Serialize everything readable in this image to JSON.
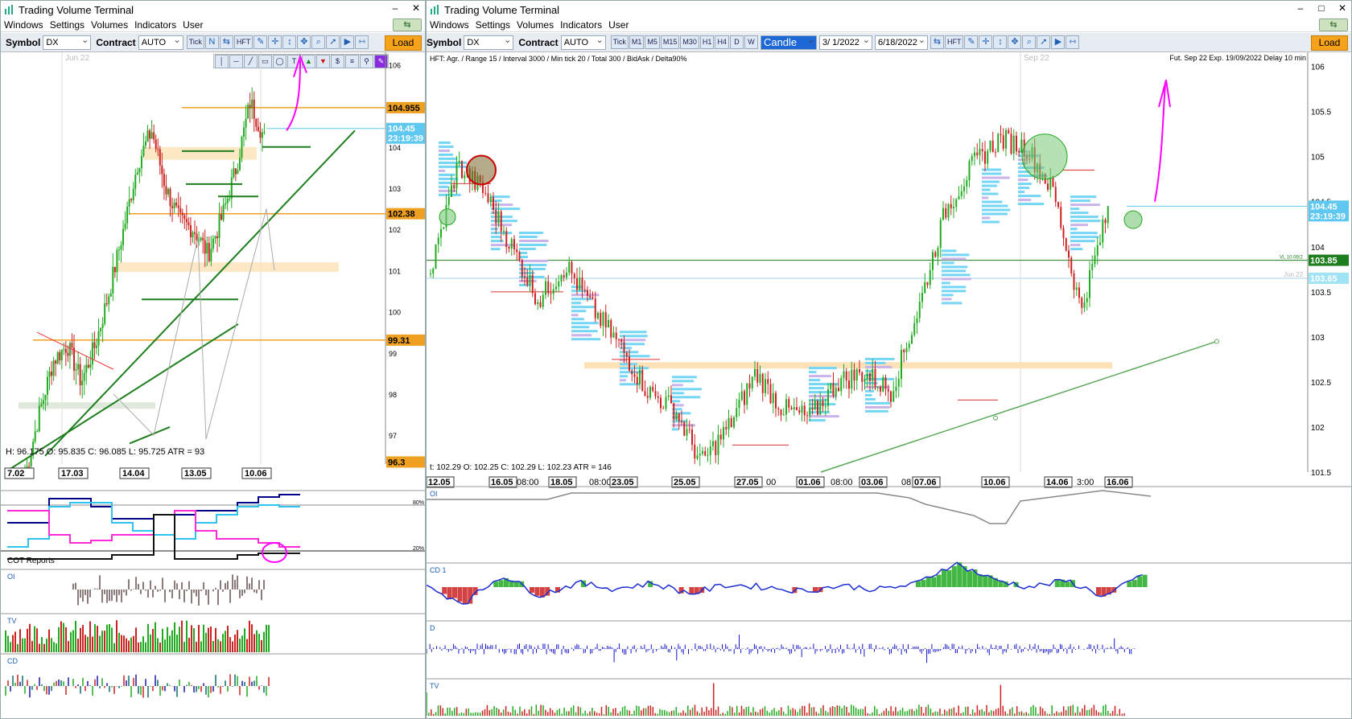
{
  "left_window": {
    "title": "Trading Volume Terminal",
    "menu": [
      "Windows",
      "Settings",
      "Volumes",
      "Indicators",
      "User"
    ],
    "toolbar": {
      "symbol_label": "Symbol",
      "symbol_value": "DX",
      "contract_label": "Contract",
      "contract_value": "AUTO",
      "tick_label": "Tick",
      "hft_label": "HFT",
      "load_label": "Load"
    },
    "chart": {
      "month_label": "Jun 22",
      "y_ticks": [
        "106",
        "104",
        "103",
        "102",
        "101",
        "100",
        "99",
        "98",
        "97"
      ],
      "price_tags": {
        "level1": "104.955",
        "current": "104.45",
        "timer": "23:19:39",
        "level2": "102.38",
        "level3": "99.31",
        "level4": "96.3"
      },
      "ohlc_text": "H: 96.175  O: 95.835  C: 96.085  L: 95.725  ATR = 93",
      "x_labels": [
        "7.02",
        "17.03",
        "14.04",
        "13.05",
        "10.06"
      ]
    },
    "panels": {
      "cot_label": "COT Reports",
      "pct_80": "80%",
      "pct_20": "20%",
      "oi_label": "OI",
      "tv_label": "TV",
      "cd_label": "CD"
    }
  },
  "right_window": {
    "title": "Trading Volume Terminal",
    "menu": [
      "Windows",
      "Settings",
      "Volumes",
      "Indicators",
      "User"
    ],
    "toolbar": {
      "symbol_label": "Symbol",
      "symbol_value": "DX",
      "contract_label": "Contract",
      "contract_value": "AUTO",
      "timeframes": [
        "Tick",
        "M1",
        "M5",
        "M15",
        "M30",
        "H1",
        "H4",
        "D",
        "W"
      ],
      "chart_type": "Candle",
      "date_from": "3/ 1/2022",
      "date_to": "6/18/2022",
      "hft_label": "HFT",
      "load_label": "Load"
    },
    "chart": {
      "info_text": "HFT: Agr. / Range 15 / Interval 3000 / Min tick 20 / Total 300 / BidAsk / Delta90%",
      "contract_info": "Fut. Sep 22 Exp. 19/09/2022 Delay 10 min",
      "month_label": "Sep 22",
      "y_ticks": [
        "106",
        "105.5",
        "105",
        "104.5",
        "104",
        "103.5",
        "103",
        "102.5",
        "102",
        "101.5"
      ],
      "price_tags": {
        "current": "104.45",
        "timer": "23:19:39",
        "level_green": "103.85",
        "level_cyan": "103.65",
        "vl_label": "VL 10.06/2",
        "jun_label": "Jun 22"
      },
      "ohlc_text": "t: 102.29  O: 102.25  C: 102.29  L: 102.23  ATR = 146",
      "x_labels": [
        "12.05",
        "16.05",
        "08:00",
        "18.05",
        "08:00",
        "23.05",
        "25.05",
        "27.05",
        "00",
        "01.06",
        "08:00",
        "03.06",
        "08",
        "07.06",
        "10.06",
        "14.06",
        "3:00",
        "16.06"
      ]
    },
    "panels": {
      "oi_label": "OI",
      "cd1_label": "CD 1",
      "d_label": "D",
      "tv_label": "TV"
    }
  },
  "colors": {
    "load": "#f7a21b",
    "orange_level": "#f0a020",
    "green_level": "#1e7e1e",
    "cyan_level": "#5ec8f0",
    "magenta": "#ff00ff",
    "bull": "#22aa22",
    "bear": "#cc2222"
  }
}
